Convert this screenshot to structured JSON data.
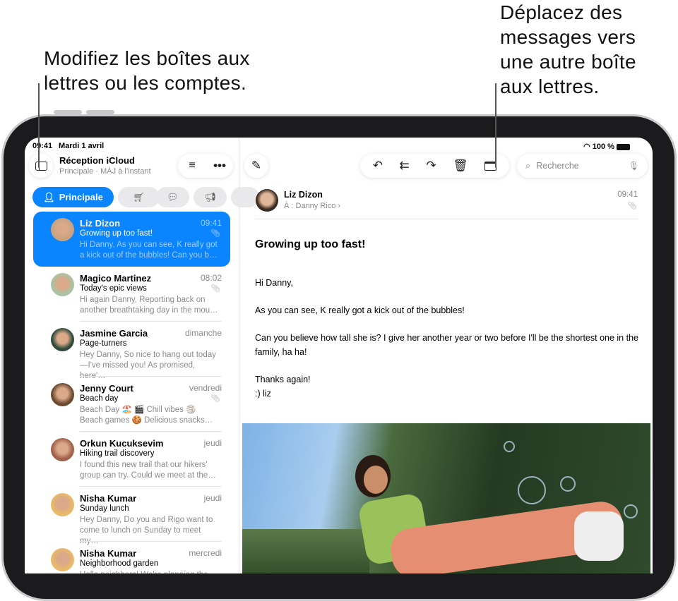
{
  "callouts": {
    "left": "Modifiez les boîtes aux lettres ou les comptes.",
    "right": "Déplacez des messages vers une autre boîte aux lettres."
  },
  "status": {
    "time": "09:41",
    "date": "Mardi 1 avril",
    "battery": "100 %"
  },
  "sidebar": {
    "title": "Réception iCloud",
    "subtitle": "Principale · MÀJ à l’instant",
    "tabs": [
      {
        "label": "Principale",
        "icon": "person-icon"
      },
      {
        "icon": "cart-icon"
      },
      {
        "icon": "chat-icon"
      },
      {
        "icon": "megaphone-icon"
      }
    ],
    "messages": [
      {
        "name": "Liz Dizon",
        "time": "09:41",
        "subject": "Growing up too fast!",
        "preview": "Hi Danny, As you can see, K really got a kick out of the bubbles! Can you b…",
        "attachment": true,
        "color": "#c9a27e"
      },
      {
        "name": "Magico Martinez",
        "time": "08:02",
        "subject": "Today's epic views",
        "preview": "Hi again Danny, Reporting back on another breathtaking day in the mou…",
        "attachment": true,
        "color": "#a9c4a3"
      },
      {
        "name": "Jasmine Garcia",
        "time": "dimanche",
        "subject": "Page-turners",
        "preview": "Hey Danny, So nice to hang out today —I've missed you! As promised, here'…",
        "attachment": false,
        "color": "#2f4a3a"
      },
      {
        "name": "Jenny Court",
        "time": "vendredi",
        "subject": "Beach day",
        "preview": "Beach Day 🏖️ 🎬 Chill vibes 🏐 Beach games 🍪 Delicious snacks…",
        "attachment": true,
        "color": "#6b4a30"
      },
      {
        "name": "Orkun Kucuksevim",
        "time": "jeudi",
        "subject": "Hiking trail discovery",
        "preview": "I found this new trail that our hikers' group can try. Could we meet at the…",
        "attachment": false,
        "color": "#a0604a"
      },
      {
        "name": "Nisha Kumar",
        "time": "jeudi",
        "subject": "Sunday lunch",
        "preview": "Hey Danny, Do you and Rigo want to come to lunch on Sunday to meet my…",
        "attachment": false,
        "color": "#e9b96a"
      },
      {
        "name": "Nisha Kumar",
        "time": "mercredi",
        "subject": "Neighborhood garden",
        "preview": "Hello neighbors! We're planning the garden…",
        "attachment": false,
        "color": "#e9b96a"
      }
    ]
  },
  "toolbar": {
    "search_placeholder": "Recherche"
  },
  "email": {
    "from": "Liz Dizon",
    "to": "À : Danny Rico",
    "time": "09:41",
    "subject": "Growing up too fast!",
    "body": [
      "Hi Danny,",
      "As you can see, K really got a kick out of the bubbles!",
      "Can you believe how tall she is? I give her another year or two before I'll be the shortest one in the family, ha ha!",
      "Thanks again!",
      ":) liz"
    ]
  }
}
